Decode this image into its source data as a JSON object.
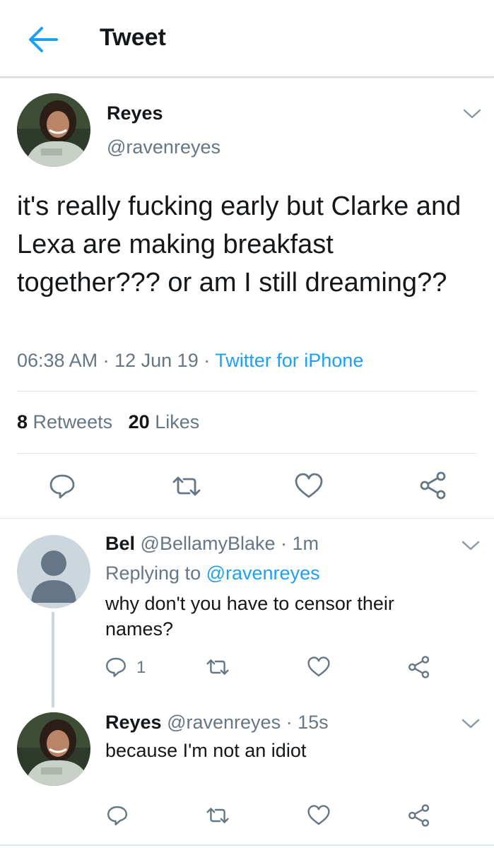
{
  "header": {
    "title": "Tweet",
    "back_icon": "arrow-left-icon"
  },
  "colors": {
    "accent": "#1da1f2",
    "secondary_text": "#657786",
    "primary_text": "#14171a",
    "divider": "#e1e8ed"
  },
  "main_tweet": {
    "display_name": "Reyes",
    "handle": "@ravenreyes",
    "text": "it's really fucking early but Clarke and Lexa are making breakfast together??? or am I still dreaming??",
    "time": "06:38 AM",
    "date": "12 Jun 19",
    "separator": "·",
    "source": "Twitter for iPhone",
    "retweets_count": "8",
    "retweets_label": "Retweets",
    "likes_count": "20",
    "likes_label": "Likes"
  },
  "replies": [
    {
      "display_name": "Bel",
      "handle": "@BellamyBlake",
      "time": "· 1m",
      "replying_label": "Replying to",
      "replying_to": "@ravenreyes",
      "text": "why don't you have to censor their names?",
      "reply_count": "1"
    },
    {
      "display_name": "Reyes",
      "handle": "@ravenreyes",
      "time": "· 15s",
      "text": "because I'm not an idiot"
    }
  ]
}
